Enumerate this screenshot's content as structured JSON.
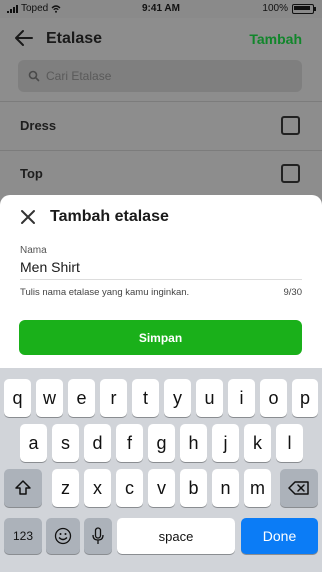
{
  "status_bar": {
    "carrier": "Toped",
    "time": "9:41 AM",
    "battery": "100%"
  },
  "header": {
    "title": "Etalase",
    "action_label": "Tambah"
  },
  "search": {
    "placeholder": "Cari Etalase"
  },
  "list": {
    "items": [
      {
        "label": "Dress"
      },
      {
        "label": "Top"
      }
    ]
  },
  "sheet": {
    "title": "Tambah etalase",
    "field_label": "Nama",
    "field_value": "Men Shirt",
    "hint": "Tulis nama etalase yang kamu inginkan.",
    "counter": "9/30",
    "save_label": "Simpan"
  },
  "keyboard": {
    "row1": [
      "q",
      "w",
      "e",
      "r",
      "t",
      "y",
      "u",
      "i",
      "o",
      "p"
    ],
    "row2": [
      "a",
      "s",
      "d",
      "f",
      "g",
      "h",
      "j",
      "k",
      "l"
    ],
    "row3": [
      "z",
      "x",
      "c",
      "v",
      "b",
      "n",
      "m"
    ],
    "numbers_label": "123",
    "space_label": "space",
    "done_label": "Done"
  },
  "colors": {
    "accent": "#11862b",
    "button": "#1ab01a",
    "done": "#0b7cf6"
  }
}
